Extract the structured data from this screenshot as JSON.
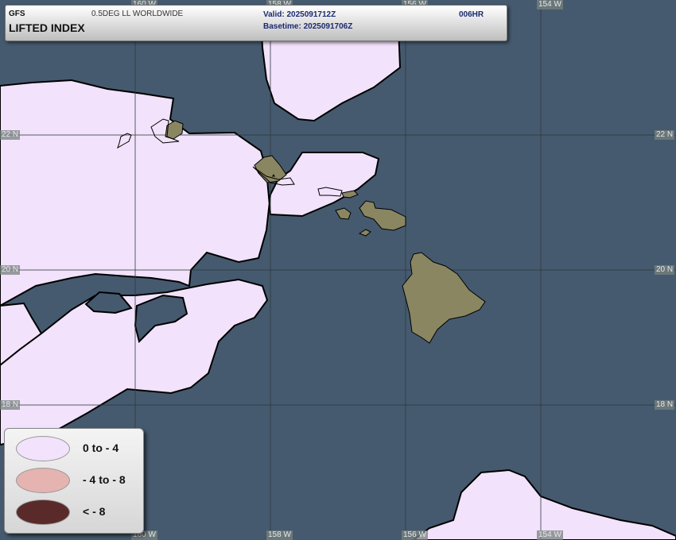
{
  "header": {
    "model": "GFS",
    "grid": "0.5DEG LL WORLDWIDE",
    "title": "LIFTED INDEX",
    "valid": "Valid: 2025091712Z",
    "basetime": "Basetime: 2025091706Z",
    "forecast_hour": "006HR"
  },
  "map": {
    "lat_labels": [
      "22 N",
      "20 N",
      "18 N"
    ],
    "lon_labels_top": [
      "160 W",
      "158 W",
      "156 W",
      "154 W"
    ],
    "lon_labels_bottom": [
      "160 W",
      "158 W",
      "156 W",
      "154 W"
    ],
    "colors": {
      "ocean": "#455a6e",
      "land": "#8a8662",
      "grid": "#30383f"
    }
  },
  "legend": {
    "items": [
      {
        "label": "0 to - 4",
        "color": "#f2e2fb"
      },
      {
        "label": "- 4 to - 8",
        "color": "#e5b3b0"
      },
      {
        "label": "< - 8",
        "color": "#5a2a2a"
      }
    ]
  }
}
